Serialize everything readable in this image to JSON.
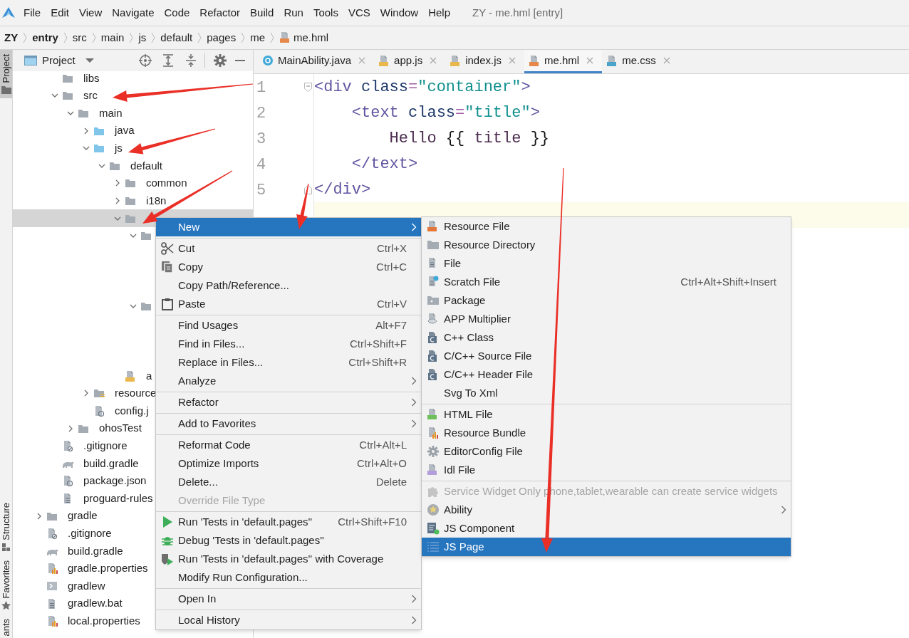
{
  "window": {
    "title": "ZY - me.hml [entry]"
  },
  "menu_bar": [
    "File",
    "Edit",
    "View",
    "Navigate",
    "Code",
    "Refactor",
    "Build",
    "Run",
    "Tools",
    "VCS",
    "Window",
    "Help"
  ],
  "breadcrumbs": [
    {
      "label": "ZY",
      "bold": true,
      "kind": "path"
    },
    {
      "label": "entry",
      "bold": true,
      "kind": "path"
    },
    {
      "label": "src",
      "bold": false,
      "kind": "path"
    },
    {
      "label": "main",
      "bold": false,
      "kind": "path"
    },
    {
      "label": "js",
      "bold": false,
      "kind": "path"
    },
    {
      "label": "default",
      "bold": false,
      "kind": "path"
    },
    {
      "label": "pages",
      "bold": false,
      "kind": "path"
    },
    {
      "label": "me",
      "bold": false,
      "kind": "path"
    },
    {
      "label": "me.hml",
      "bold": false,
      "kind": "hml_file"
    }
  ],
  "tool_windows": [
    {
      "label": "Project",
      "selected": true,
      "kind": "project"
    },
    {
      "label": "Structure",
      "selected": false,
      "kind": "structure"
    },
    {
      "label": "Favorites",
      "selected": false,
      "kind": "favorites"
    },
    {
      "label": "ants",
      "selected": false,
      "kind": "plain"
    }
  ],
  "project_panel": {
    "title": "Project",
    "tree": [
      {
        "kind": "offscreen",
        "children": [
          {
            "label": "libs",
            "kind": "folder",
            "selected": false
          },
          {
            "label": "src",
            "kind": "folder",
            "expanded": true,
            "selected": false,
            "children": [
              {
                "label": "main",
                "kind": "folder",
                "expanded": true,
                "selected": false,
                "children": [
                  {
                    "label": "java",
                    "kind": "source_folder",
                    "expanded": false,
                    "selected": false
                  },
                  {
                    "label": "js",
                    "kind": "source_folder",
                    "expanded": true,
                    "selected": false,
                    "children": [
                      {
                        "label": "default",
                        "kind": "folder",
                        "expanded": true,
                        "selected": false,
                        "children": [
                          {
                            "label": "common",
                            "kind": "folder",
                            "expanded": false,
                            "selected": false
                          },
                          {
                            "label": "i18n",
                            "kind": "folder",
                            "expanded": false,
                            "selected": false
                          },
                          {
                            "kind": "folder",
                            "expanded": true,
                            "selected": true,
                            "children": [
                              {
                                "kind": "folder",
                                "expanded": true,
                                "selected": false
                              },
                              {
                                "kind": "folder",
                                "expanded": true,
                                "selected": false
                              }
                            ]
                          },
                          {
                            "label": "a",
                            "kind": "js_file",
                            "selected": false
                          }
                        ]
                      }
                    ]
                  },
                  {
                    "label": "resource",
                    "kind": "resources_folder",
                    "expanded": false,
                    "selected": false
                  },
                  {
                    "label": "config.j",
                    "kind": "json_file",
                    "selected": false
                  }
                ]
              },
              {
                "label": "ohosTest",
                "kind": "folder",
                "expanded": false,
                "selected": false
              }
            ]
          },
          {
            "label": ".gitignore",
            "kind": "gitignore",
            "selected": false
          },
          {
            "label": "build.gradle",
            "kind": "gradle",
            "selected": false
          },
          {
            "label": "package.json",
            "kind": "json_file",
            "selected": false
          },
          {
            "label": "proguard-rules",
            "kind": "text_file",
            "selected": false
          }
        ]
      },
      {
        "label": "gradle",
        "kind": "folder",
        "expanded": false,
        "selected": false
      },
      {
        "label": ".gitignore",
        "kind": "gitignore",
        "selected": false
      },
      {
        "label": "build.gradle",
        "kind": "gradle",
        "selected": false
      },
      {
        "label": "gradle.properties",
        "kind": "properties_file",
        "selected": false
      },
      {
        "label": "gradlew",
        "kind": "script_file",
        "selected": false
      },
      {
        "label": "gradlew.bat",
        "kind": "text_file",
        "selected": false
      },
      {
        "label": "local.properties",
        "kind": "properties_file",
        "selected": false
      }
    ]
  },
  "editor": {
    "tabs": [
      {
        "label": "MainAbility.java",
        "kind": "java",
        "selected": false
      },
      {
        "label": "app.js",
        "kind": "js",
        "selected": false
      },
      {
        "label": "index.js",
        "kind": "js",
        "selected": false
      },
      {
        "label": "me.hml",
        "kind": "hml",
        "selected": true
      },
      {
        "label": "me.css",
        "kind": "css",
        "selected": false
      }
    ],
    "lines": [
      {
        "number": "1",
        "kind": "fold_start",
        "current": false,
        "tokens": [
          {
            "kind": "tag",
            "text": "<div"
          },
          {
            "kind": "attr",
            "text": " class"
          },
          {
            "kind": "eq",
            "text": "="
          },
          {
            "kind": "string",
            "text": "\"container\""
          },
          {
            "kind": "tag",
            "text": ">"
          }
        ]
      },
      {
        "number": "2",
        "kind": "plain",
        "current": false,
        "tokens": [
          {
            "kind": "tag",
            "text": "    <text"
          },
          {
            "kind": "attr",
            "text": " class"
          },
          {
            "kind": "eq",
            "text": "="
          },
          {
            "kind": "string",
            "text": "\"title\""
          },
          {
            "kind": "tag",
            "text": ">"
          }
        ]
      },
      {
        "number": "3",
        "kind": "plain",
        "current": false,
        "tokens": [
          {
            "kind": "text",
            "text": "        Hello "
          },
          {
            "kind": "brace",
            "text": "{{"
          },
          {
            "kind": "text",
            "text": " title "
          },
          {
            "kind": "brace",
            "text": "}}"
          }
        ]
      },
      {
        "number": "4",
        "kind": "plain",
        "current": false,
        "tokens": [
          {
            "kind": "tag",
            "text": "    </text>"
          }
        ]
      },
      {
        "number": "5",
        "kind": "fold_end",
        "current": false,
        "tokens": [
          {
            "kind": "tag",
            "text": "</div>"
          }
        ]
      },
      {
        "kind": "plain",
        "current": true
      }
    ]
  },
  "context_menu": {
    "items": [
      {
        "kind": "plain",
        "label": "New",
        "submenu": true,
        "selected": true,
        "disabled": false
      },
      {
        "kind": "separator"
      },
      {
        "kind": "cut",
        "label": "Cut",
        "shortcut": "Ctrl+X",
        "submenu": false,
        "selected": false,
        "disabled": false
      },
      {
        "kind": "copy",
        "label": "Copy",
        "shortcut": "Ctrl+C",
        "submenu": false,
        "selected": false,
        "disabled": false
      },
      {
        "kind": "plain",
        "label": "Copy Path/Reference...",
        "submenu": false,
        "selected": false,
        "disabled": false
      },
      {
        "kind": "paste",
        "label": "Paste",
        "shortcut": "Ctrl+V",
        "submenu": false,
        "selected": false,
        "disabled": false
      },
      {
        "kind": "separator"
      },
      {
        "kind": "plain",
        "label": "Find Usages",
        "shortcut": "Alt+F7",
        "submenu": false,
        "selected": false,
        "disabled": false
      },
      {
        "kind": "plain",
        "label": "Find in Files...",
        "shortcut": "Ctrl+Shift+F",
        "submenu": false,
        "selected": false,
        "disabled": false
      },
      {
        "kind": "plain",
        "label": "Replace in Files...",
        "shortcut": "Ctrl+Shift+R",
        "submenu": false,
        "selected": false,
        "disabled": false
      },
      {
        "kind": "plain",
        "label": "Analyze",
        "submenu": true,
        "selected": false,
        "disabled": false
      },
      {
        "kind": "separator"
      },
      {
        "kind": "plain",
        "label": "Refactor",
        "submenu": true,
        "selected": false,
        "disabled": false
      },
      {
        "kind": "separator"
      },
      {
        "kind": "plain",
        "label": "Add to Favorites",
        "submenu": true,
        "selected": false,
        "disabled": false
      },
      {
        "kind": "separator"
      },
      {
        "kind": "plain",
        "label": "Reformat Code",
        "shortcut": "Ctrl+Alt+L",
        "submenu": false,
        "selected": false,
        "disabled": false
      },
      {
        "kind": "plain",
        "label": "Optimize Imports",
        "shortcut": "Ctrl+Alt+O",
        "submenu": false,
        "selected": false,
        "disabled": false
      },
      {
        "kind": "plain",
        "label": "Delete...",
        "shortcut": "Delete",
        "submenu": false,
        "selected": false,
        "disabled": false
      },
      {
        "kind": "plain",
        "label": "Override File Type",
        "submenu": false,
        "selected": false,
        "disabled": true
      },
      {
        "kind": "separator"
      },
      {
        "kind": "run",
        "label": "Run 'Tests in 'default.pages''",
        "shortcut": "Ctrl+Shift+F10",
        "submenu": false,
        "selected": false,
        "disabled": false
      },
      {
        "kind": "debug",
        "label": "Debug 'Tests in 'default.pages''",
        "submenu": false,
        "selected": false,
        "disabled": false
      },
      {
        "kind": "coverage",
        "label": "Run 'Tests in 'default.pages'' with Coverage",
        "submenu": false,
        "selected": false,
        "disabled": false
      },
      {
        "kind": "plain",
        "label": "Modify Run Configuration...",
        "submenu": false,
        "selected": false,
        "disabled": false
      },
      {
        "kind": "separator"
      },
      {
        "kind": "plain",
        "label": "Open In",
        "submenu": true,
        "selected": false,
        "disabled": false
      },
      {
        "kind": "separator"
      },
      {
        "kind": "plain",
        "label": "Local History",
        "submenu": true,
        "selected": false,
        "disabled": false
      }
    ]
  },
  "new_submenu": {
    "items": [
      {
        "kind": "resource_file",
        "label": "Resource File",
        "submenu": false,
        "selected": false,
        "disabled": false
      },
      {
        "kind": "folder",
        "label": "Resource Directory",
        "submenu": false,
        "selected": false,
        "disabled": false
      },
      {
        "kind": "file",
        "label": "File",
        "submenu": false,
        "selected": false,
        "disabled": false
      },
      {
        "kind": "scratch",
        "label": "Scratch File",
        "shortcut": "Ctrl+Alt+Shift+Insert",
        "submenu": false,
        "selected": false,
        "disabled": false
      },
      {
        "kind": "package",
        "label": "Package",
        "submenu": false,
        "selected": false,
        "disabled": false
      },
      {
        "kind": "multiplier",
        "label": "APP Multiplier",
        "submenu": false,
        "selected": false,
        "disabled": false
      },
      {
        "kind": "cpp",
        "label": "C++ Class",
        "submenu": false,
        "selected": false,
        "disabled": false
      },
      {
        "kind": "cpp",
        "label": "C/C++ Source File",
        "submenu": false,
        "selected": false,
        "disabled": false
      },
      {
        "kind": "cpp",
        "label": "C/C++ Header File",
        "submenu": false,
        "selected": false,
        "disabled": false
      },
      {
        "kind": "plain",
        "label": "Svg To Xml",
        "submenu": false,
        "selected": false,
        "disabled": false
      },
      {
        "kind": "separator"
      },
      {
        "kind": "html",
        "label": "HTML File",
        "submenu": false,
        "selected": false,
        "disabled": false
      },
      {
        "kind": "bundle",
        "label": "Resource Bundle",
        "submenu": false,
        "selected": false,
        "disabled": false
      },
      {
        "kind": "gear",
        "label": "EditorConfig File",
        "submenu": false,
        "selected": false,
        "disabled": false
      },
      {
        "kind": "idl",
        "label": "Idl File",
        "submenu": false,
        "selected": false,
        "disabled": false
      },
      {
        "kind": "separator"
      },
      {
        "kind": "puzzle",
        "label": "Service Widget Only phone,tablet,wearable can create service widgets",
        "submenu": false,
        "selected": false,
        "disabled": true
      },
      {
        "kind": "ability",
        "label": "Ability",
        "submenu": true,
        "selected": false,
        "disabled": false
      },
      {
        "kind": "component",
        "label": "JS Component",
        "submenu": false,
        "selected": false,
        "disabled": false
      },
      {
        "kind": "page",
        "label": "JS Page",
        "submenu": false,
        "selected": true,
        "disabled": false
      }
    ]
  }
}
